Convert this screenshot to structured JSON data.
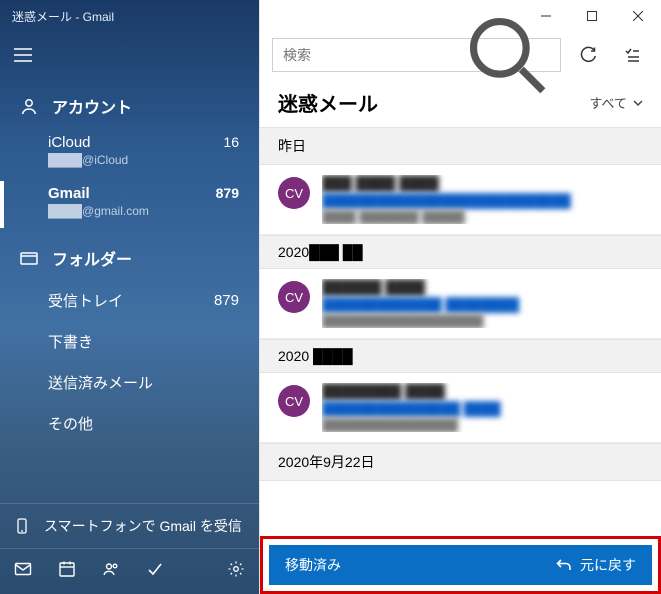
{
  "window": {
    "title": "迷惑メール - Gmail"
  },
  "sidebar": {
    "accounts_label": "アカウント",
    "accounts": [
      {
        "name": "iCloud",
        "email": "████@iCloud",
        "count": "16",
        "selected": false
      },
      {
        "name": "Gmail",
        "email": "████@gmail.com",
        "count": "879",
        "selected": true
      }
    ],
    "folders_label": "フォルダー",
    "folders": [
      {
        "label": "受信トレイ",
        "count": "879"
      },
      {
        "label": "下書き",
        "count": ""
      },
      {
        "label": "送信済みメール",
        "count": ""
      },
      {
        "label": "その他",
        "count": ""
      }
    ],
    "promo": "スマートフォンで Gmail を受信"
  },
  "toolbar": {
    "search_placeholder": "検索"
  },
  "main": {
    "heading": "迷惑メール",
    "filter_label": "すべて"
  },
  "groups": [
    {
      "label": "昨日"
    },
    {
      "label": "2020███ ██"
    },
    {
      "label": "2020 ████"
    },
    {
      "label": "2020年9月22日"
    }
  ],
  "mails": [
    {
      "avatar": "CV",
      "from": "███ ████ ████",
      "subject": "███████████████████████████",
      "preview": "████ ███████ █████"
    },
    {
      "avatar": "CV",
      "from": "██████ ████",
      "subject": "█████████████ ████████",
      "preview": "███████████████████"
    },
    {
      "avatar": "CV",
      "from": "████████ ████",
      "subject": "███████████████ ████",
      "preview": "████████████████"
    }
  ],
  "action_bar": {
    "message": "移動済み",
    "undo_label": "元に戻す"
  }
}
